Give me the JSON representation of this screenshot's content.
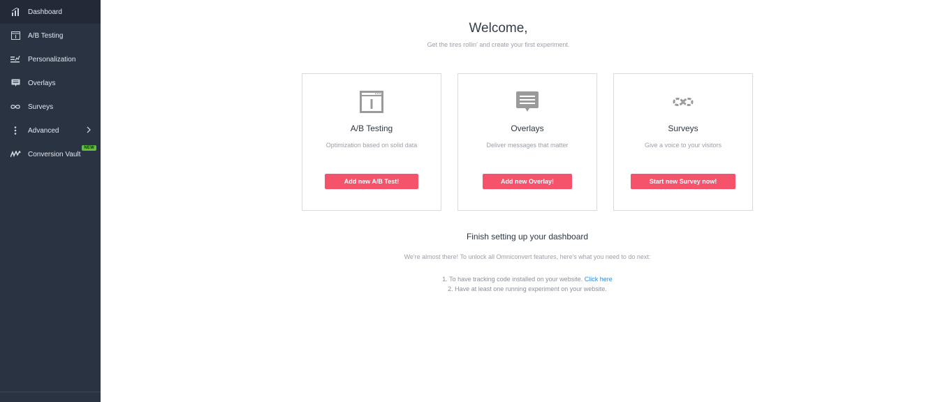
{
  "sidebar": {
    "items": [
      {
        "label": "Dashboard",
        "icon": "dashboard-icon",
        "active": true
      },
      {
        "label": "A/B Testing",
        "icon": "ab-testing-icon"
      },
      {
        "label": "Personalization",
        "icon": "personalization-icon"
      },
      {
        "label": "Overlays",
        "icon": "overlays-icon"
      },
      {
        "label": "Surveys",
        "icon": "surveys-icon"
      },
      {
        "label": "Advanced",
        "icon": "more-vertical-icon"
      },
      {
        "label": "Conversion Vault",
        "icon": "conversion-vault-icon",
        "badge": "NEW"
      }
    ]
  },
  "welcome": {
    "title": "Welcome,",
    "subtitle": "Get the tires rollin' and create your first experiment."
  },
  "cards": [
    {
      "title": "A/B Testing",
      "description": "Optimization based on solid data",
      "button": "Add new A/B Test!",
      "icon": "browser-window-icon"
    },
    {
      "title": "Overlays",
      "description": "Deliver messages that matter",
      "button": "Add new Overlay!",
      "icon": "chat-bubble-icon"
    },
    {
      "title": "Surveys",
      "description": "Give a voice to your visitors",
      "button": "Start new Survey now!",
      "icon": "infinity-icon"
    }
  ],
  "setup": {
    "title": "Finish setting up your dashboard",
    "subtitle": "We're almost there! To unlock all Omniconvert features, here's what you need to do next:",
    "step1": "1. To have tracking code installed on your website. ",
    "step1_link": "Click here",
    "step2": "2. Have at least one running experiment on your website."
  },
  "colors": {
    "sidebar_bg": "#2a3342",
    "button": "#f4536b",
    "badge": "#5dc13c",
    "link": "#2f8bd6"
  }
}
